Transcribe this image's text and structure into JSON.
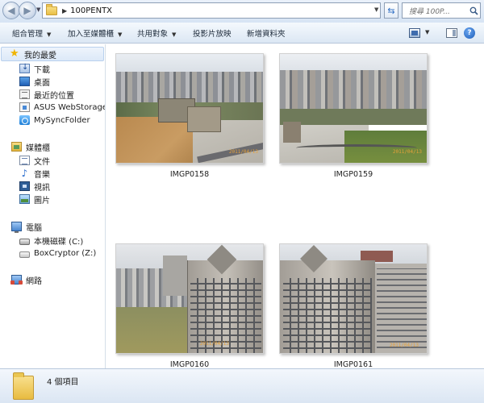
{
  "address_bar": {
    "breadcrumb": [
      "100PENTX"
    ],
    "search_placeholder": "搜尋 100P..."
  },
  "toolbar": {
    "organize": "組合管理",
    "add_to_library": "加入至媒體櫃",
    "share_with": "共用對象",
    "slideshow": "投影片放映",
    "new_folder": "新增資料夾"
  },
  "nav_pane": {
    "favorites": {
      "label": "我的最愛",
      "items": [
        "下載",
        "桌面",
        "最近的位置",
        "ASUS WebStorage Dr",
        "MySyncFolder"
      ]
    },
    "libraries": {
      "label": "媒體櫃",
      "items": [
        "文件",
        "音樂",
        "視訊",
        "圖片"
      ]
    },
    "computer": {
      "label": "電腦",
      "items": [
        "本機磁碟 (C:)",
        "BoxCryptor (Z:)"
      ]
    },
    "network": {
      "label": "網路"
    }
  },
  "files": [
    {
      "name": "IMGP0158",
      "date_stamp": "2011/04/13"
    },
    {
      "name": "IMGP0159",
      "date_stamp": "2011/04/13"
    },
    {
      "name": "IMGP0160",
      "date_stamp": "2011/04/13"
    },
    {
      "name": "IMGP0161",
      "date_stamp": "2011/04/13"
    }
  ],
  "status": {
    "item_count": "4 個項目"
  },
  "icons": {
    "back": "back-arrow-icon",
    "forward": "forward-arrow-icon",
    "refresh": "refresh-icon",
    "search": "search-icon",
    "views": "views-icon",
    "preview_pane": "preview-pane-icon",
    "help": "help-icon"
  },
  "colors": {
    "chrome_top": "#eaf1fa",
    "chrome_bottom": "#d7e4f4",
    "selection": "#dce9f8",
    "folder": "#e9bf46"
  }
}
